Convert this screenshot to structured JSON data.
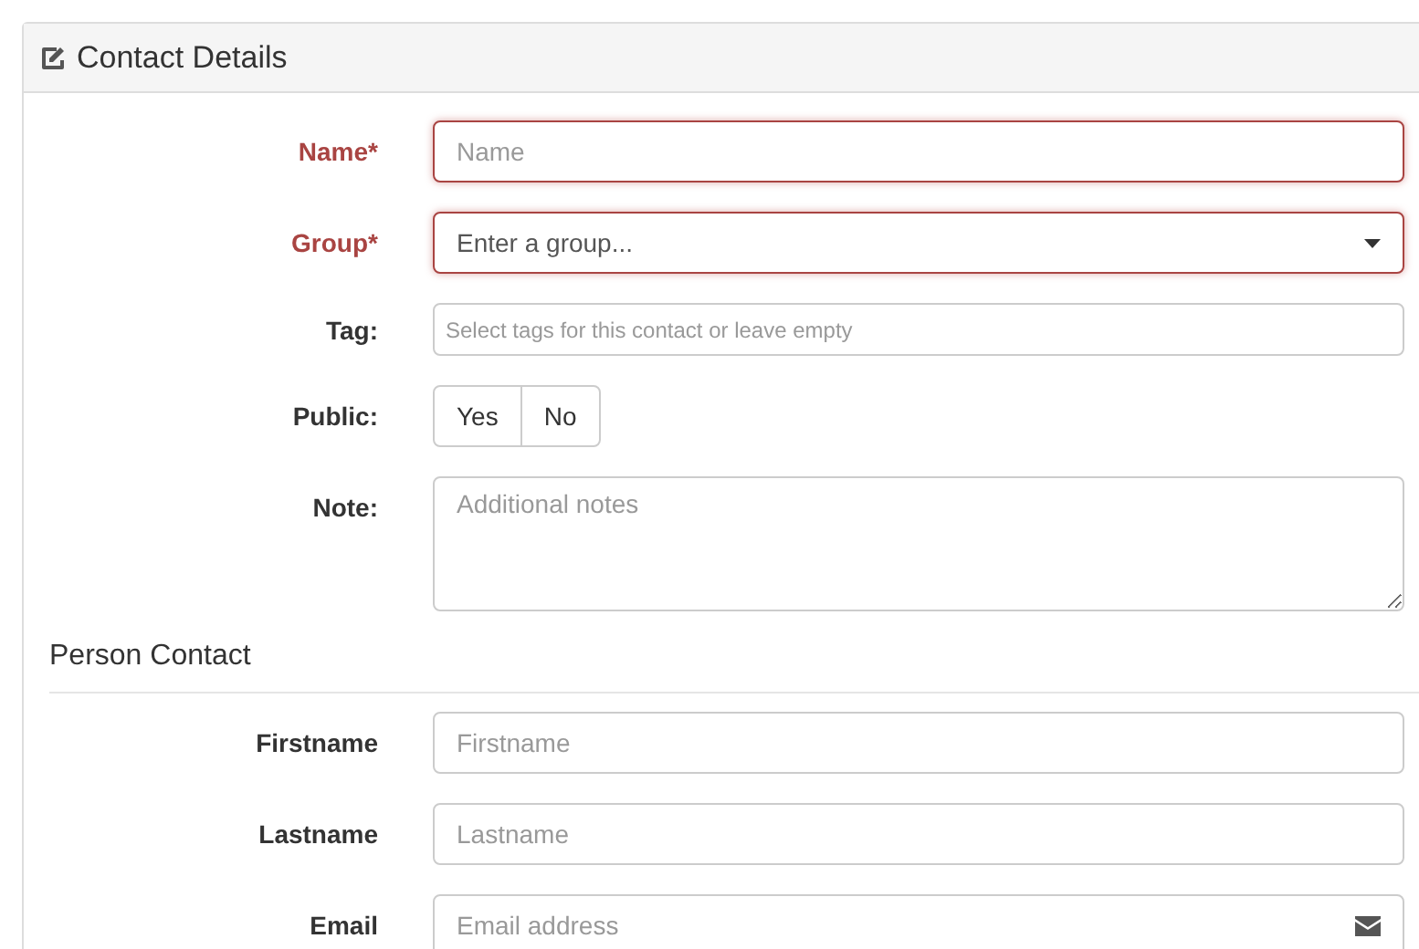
{
  "panel": {
    "title": "Contact Details"
  },
  "fields": [
    {
      "kind": "text",
      "label": "Name*",
      "placeholder": "Name",
      "error": true
    },
    {
      "kind": "select",
      "label": "Group*",
      "placeholder": "Enter a group...",
      "error": true
    },
    {
      "kind": "tags",
      "label": "Tag:",
      "placeholder": "Select tags for this contact or leave empty",
      "error": false
    },
    {
      "kind": "toggle",
      "label": "Public:",
      "error": false,
      "options": [
        {
          "label": "Yes",
          "selected": false
        },
        {
          "label": "No",
          "selected": false
        }
      ]
    },
    {
      "kind": "textarea",
      "label": "Note:",
      "placeholder": "Additional notes",
      "error": false
    }
  ],
  "section": {
    "title": "Person Contact"
  },
  "person_fields": [
    {
      "kind": "text",
      "label": "Firstname",
      "placeholder": "Firstname",
      "error": false
    },
    {
      "kind": "text",
      "label": "Lastname",
      "placeholder": "Lastname",
      "error": false
    },
    {
      "kind": "email",
      "label": "Email",
      "placeholder": "Email address",
      "error": false
    }
  ]
}
